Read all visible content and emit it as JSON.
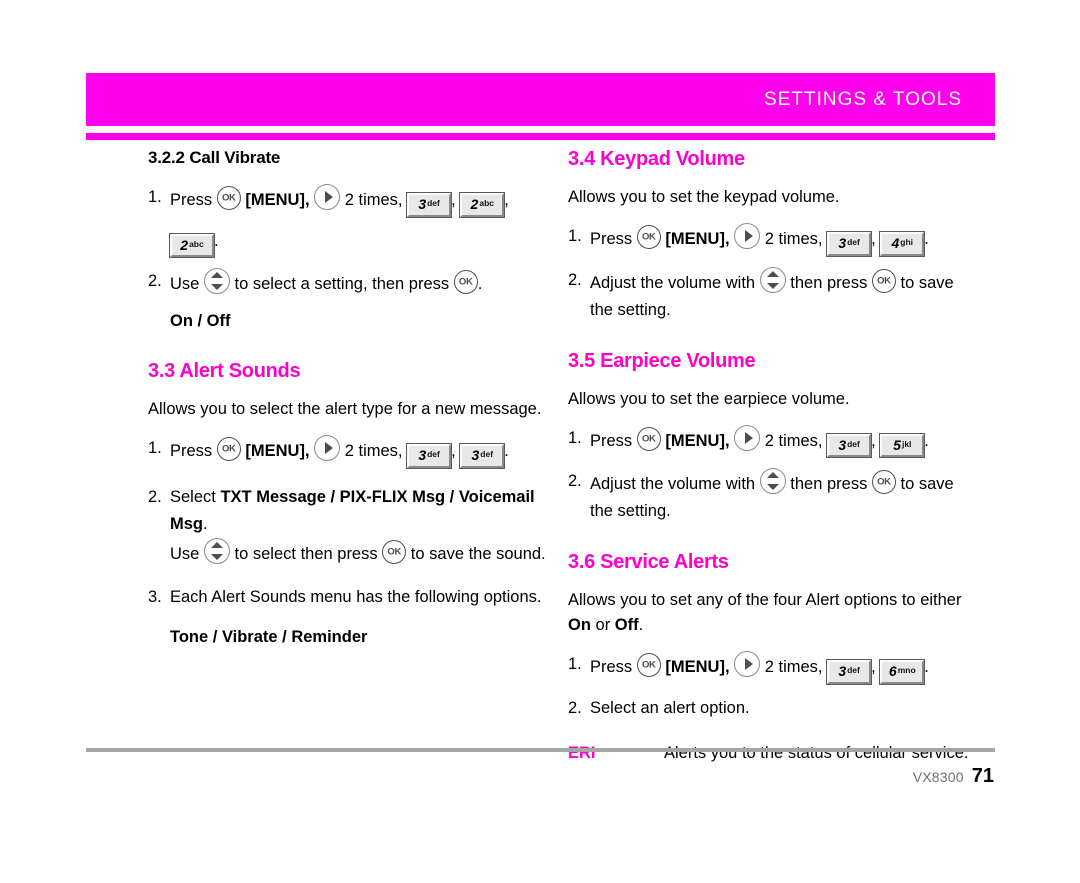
{
  "header": {
    "title": "SETTINGS & TOOLS",
    "banner_color": "#ff00ee",
    "title_color": "#ffffff"
  },
  "theme": {
    "accent": "#ff00cc",
    "text": "#000000",
    "rule": "#a6a6a6"
  },
  "left_column": {
    "subsection": {
      "heading": "3.2.2 Call Vibrate",
      "step1": {
        "num": "1.",
        "press": "Press",
        "menu": "[MENU],",
        "times": "2 times,",
        "keys": [
          {
            "digit": "3",
            "letters": "def"
          },
          {
            "digit": "2",
            "letters": "abc"
          }
        ],
        "comma": ",",
        "wrap_key": {
          "digit": "2",
          "letters": "abc"
        },
        "period": "."
      },
      "step2": {
        "num": "2.",
        "use": "Use",
        "tail": "to select a setting, then press",
        "period": ".",
        "options": "On / Off"
      }
    },
    "section_33": {
      "heading": "3.3 Alert Sounds",
      "intro": "Allows you to select the alert type for a new message.",
      "step1": {
        "num": "1.",
        "press": "Press",
        "menu": "[MENU],",
        "times": "2 times,",
        "keys": [
          {
            "digit": "3",
            "letters": "def"
          },
          {
            "digit": "3",
            "letters": "def"
          }
        ],
        "comma": ",",
        "period": "."
      },
      "step2": {
        "num": "2.",
        "select": "Select",
        "bold_options": "TXT Message / PIX-FLIX Msg / Voicemail Msg",
        "period": ".",
        "use": "Use",
        "tail": "to select then press",
        "tail2": "to save the sound."
      },
      "step3": {
        "num": "3.",
        "text": "Each Alert Sounds menu has the following options.",
        "options": "Tone / Vibrate / Reminder"
      }
    }
  },
  "right_column": {
    "section_34": {
      "heading": "3.4 Keypad Volume",
      "intro": "Allows you to set the keypad volume.",
      "step1": {
        "num": "1.",
        "press": "Press",
        "menu": "[MENU],",
        "times": "2 times,",
        "keys": [
          {
            "digit": "3",
            "letters": "def"
          },
          {
            "digit": "4",
            "letters": "ghi"
          }
        ],
        "comma": ",",
        "period": "."
      },
      "step2": {
        "num": "2.",
        "lead": "Adjust the volume with",
        "mid": "then press",
        "tail": "to save the setting."
      }
    },
    "section_35": {
      "heading": "3.5 Earpiece Volume",
      "intro": "Allows you to set the earpiece volume.",
      "step1": {
        "num": "1.",
        "press": "Press",
        "menu": "[MENU],",
        "times": "2 times,",
        "keys": [
          {
            "digit": "3",
            "letters": "def"
          },
          {
            "digit": "5",
            "letters": "jkl"
          }
        ],
        "comma": ",",
        "period": "."
      },
      "step2": {
        "num": "2.",
        "lead": "Adjust the volume with",
        "mid": "then press",
        "tail": "to save the setting."
      }
    },
    "section_36": {
      "heading": "3.6 Service Alerts",
      "intro_a": "Allows you to set any of the four Alert options to either",
      "intro_on": "On",
      "intro_or": "or",
      "intro_off": "Off",
      "intro_period": ".",
      "step1": {
        "num": "1.",
        "press": "Press",
        "menu": "[MENU],",
        "times": "2 times,",
        "keys": [
          {
            "digit": "3",
            "letters": "def"
          },
          {
            "digit": "6",
            "letters": "mno"
          }
        ],
        "comma": ",",
        "period": "."
      },
      "step2": {
        "num": "2.",
        "text": "Select an alert option."
      },
      "definition": {
        "term": "ERI",
        "description": "Alerts you to the status of cellular service."
      }
    }
  },
  "footer": {
    "model": "VX8300",
    "page": "71"
  }
}
